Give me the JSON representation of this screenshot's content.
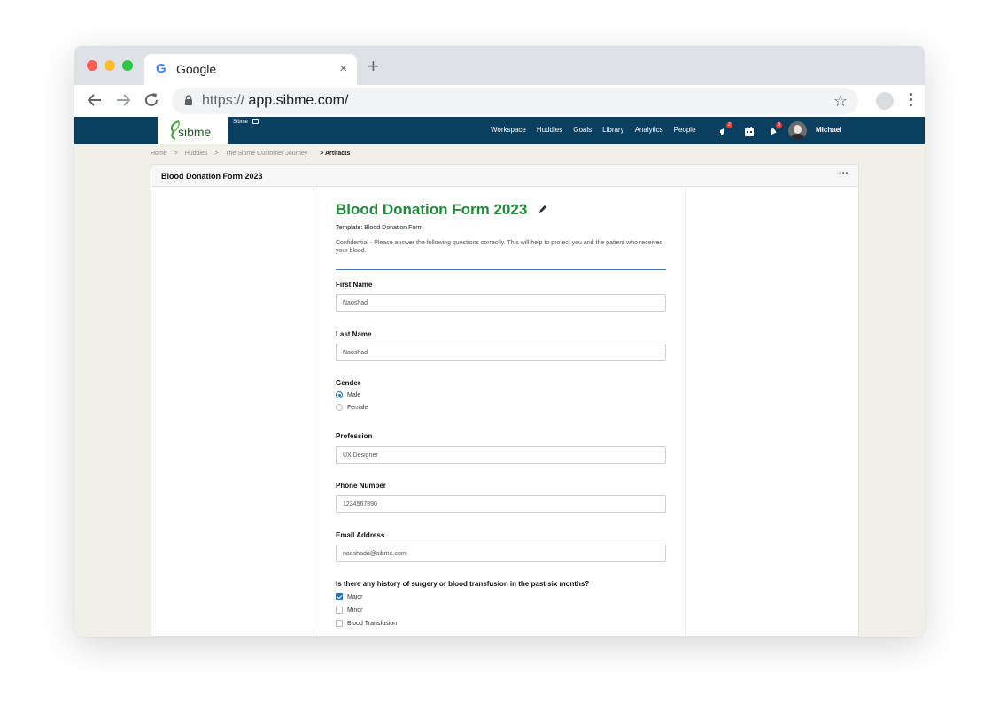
{
  "browser": {
    "tab_title": "Google",
    "tab_favicon": "G",
    "tab_close": "×",
    "new_tab": "+",
    "url_scheme": "https://",
    "url_host": "app.sibme.com/"
  },
  "appbar": {
    "logo_text": "sibme",
    "account_name": "Sibme",
    "nav": [
      "Workspace",
      "Huddles",
      "Goals",
      "Library",
      "Analytics",
      "People"
    ],
    "badges": {
      "activity": "2",
      "notifications": "3"
    },
    "user_name": "Michael",
    "colors": {
      "bar": "#0b3f60",
      "accent": "#1e8a3a"
    }
  },
  "breadcrumb": {
    "items": [
      "Home",
      "Huddles",
      "The Sibme Customer Journey"
    ],
    "separator": ">",
    "current": "> Artifacts"
  },
  "panel": {
    "title": "Blood Donation Form 2023",
    "more": "···"
  },
  "form": {
    "title": "Blood Donation Form 2023",
    "template": "Template: Blood Donation Form",
    "confidential": "Confidential - Please answer the following questions correctly. This will help to protect you and the patient who receives your blood.",
    "first_name": {
      "label": "First Name",
      "value": "Naoshad"
    },
    "last_name": {
      "label": "Last Name",
      "value": "Naoshad"
    },
    "gender": {
      "label": "Gender",
      "options": [
        "Male",
        "Female"
      ],
      "selected": "Male"
    },
    "profession": {
      "label": "Profession",
      "value": "UX Designer"
    },
    "phone": {
      "label": "Phone Number",
      "value": "1234567890"
    },
    "email": {
      "label": "Email Address",
      "value": "naoshada@sibme.com"
    },
    "history": {
      "label": "Is there any history of surgery or blood transfusion in the past six months?",
      "options": [
        "Major",
        "Minor",
        "Blood Transfusion"
      ],
      "checked": [
        "Major"
      ]
    }
  }
}
